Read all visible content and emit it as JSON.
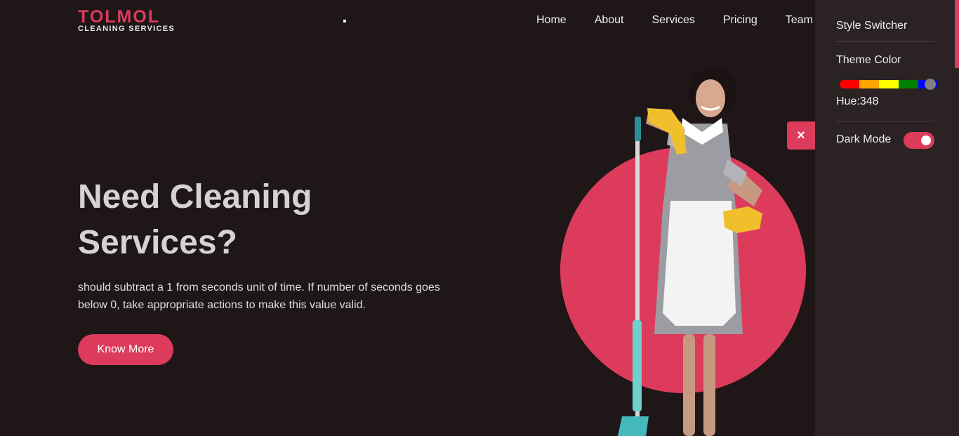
{
  "logo": {
    "title": "TOLMOL",
    "subtitle": "CLEANING SERVICES"
  },
  "nav": {
    "items": [
      "Home",
      "About",
      "Services",
      "Pricing",
      "Team"
    ]
  },
  "hero": {
    "title": "Need Cleaning Services?",
    "text": "should subtract a 1 from seconds unit of time. If number of seconds goes below 0, take appropriate actions to make this value valid.",
    "button": "Know More"
  },
  "close_icon": "×",
  "switcher": {
    "title": "Style Switcher",
    "theme_label": "Theme Color",
    "hue_label": "Hue:348",
    "hue_position": 0.92,
    "hue_colors": [
      "#ff0000",
      "#ffa500",
      "#ffff00",
      "#008000",
      "#0000ff"
    ],
    "dark_mode_label": "Dark Mode",
    "dark_mode_on": true
  },
  "colors": {
    "accent": "#dc3b5c",
    "background": "#1e1617",
    "panel": "#2b2323"
  }
}
